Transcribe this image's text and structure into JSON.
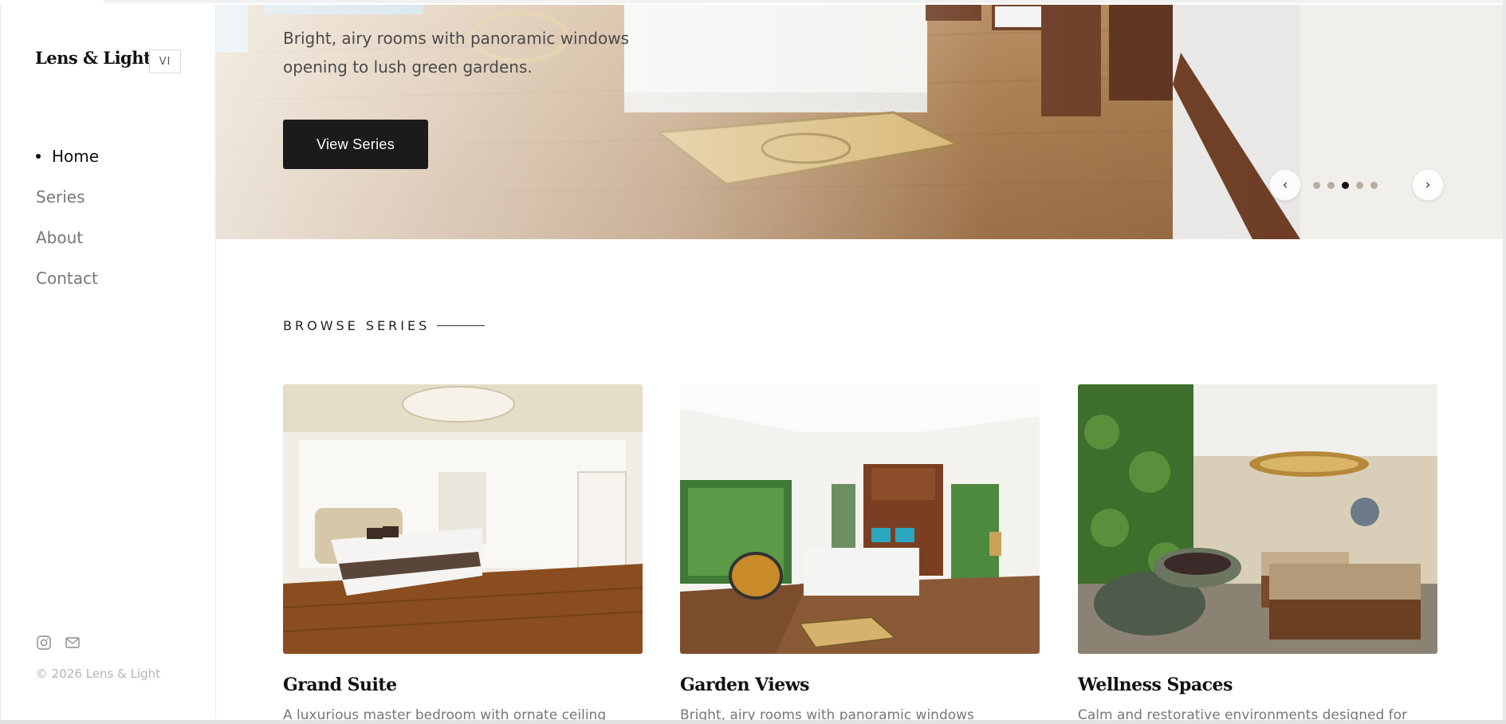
{
  "sidebar": {
    "brand": "Lens & Light",
    "language": "VI",
    "nav": [
      {
        "label": "Home",
        "active": true
      },
      {
        "label": "Series",
        "active": false
      },
      {
        "label": "About",
        "active": false
      },
      {
        "label": "Contact",
        "active": false
      }
    ],
    "social_icons": [
      "instagram-icon",
      "mail-icon"
    ],
    "copyright": "© 2026 Lens & Light"
  },
  "hero": {
    "description": "Bright, airy rooms with panoramic windows opening to lush green gardens.",
    "cta_label": "View Series",
    "prev_label": "‹",
    "next_label": "›",
    "slide_count": 5,
    "active_slide": 3
  },
  "browse": {
    "title": "BROWSE SERIES",
    "cards": [
      {
        "title": "Grand Suite",
        "description": "A luxurious master bedroom with ornate ceiling"
      },
      {
        "title": "Garden Views",
        "description": "Bright, airy rooms with panoramic windows"
      },
      {
        "title": "Wellness Spaces",
        "description": "Calm and restorative environments designed for"
      }
    ]
  }
}
